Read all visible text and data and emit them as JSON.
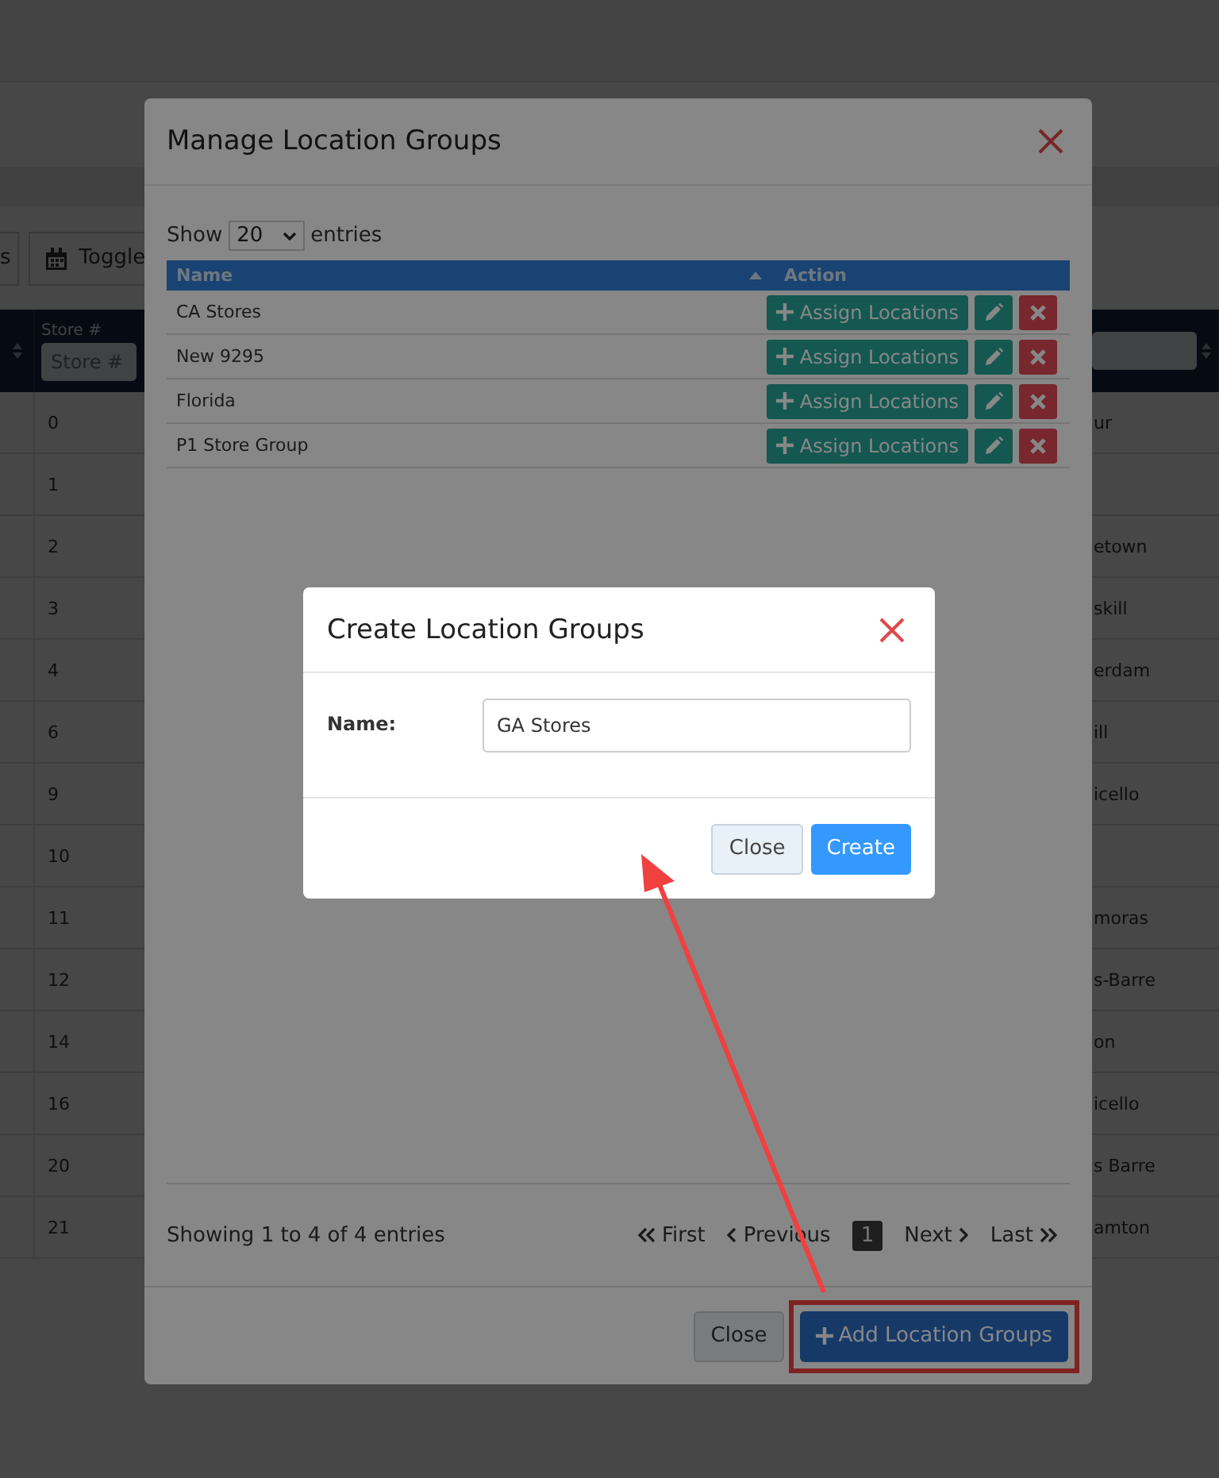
{
  "background_page": {
    "toolbar_items": [
      {
        "label": "s",
        "kind": "text"
      },
      {
        "label": "Toggle",
        "kind": "calendar"
      }
    ],
    "table": {
      "columns": [
        {
          "kind": "sort"
        },
        {
          "kind": "filter",
          "label": "Store #",
          "placeholder": "Store #"
        },
        {
          "kind": "filter_sort"
        }
      ],
      "rows": [
        {
          "store": "0",
          "column_3": "ur"
        },
        {
          "store": "1",
          "column_3": ""
        },
        {
          "store": "2",
          "column_3": "etown"
        },
        {
          "store": "3",
          "column_3": "skill"
        },
        {
          "store": "4",
          "column_3": "erdam"
        },
        {
          "store": "6",
          "column_3": "ill"
        },
        {
          "store": "9",
          "column_3": "icello"
        },
        {
          "store": "10",
          "column_3": ""
        },
        {
          "store": "11",
          "column_3": "moras"
        },
        {
          "store": "12",
          "column_3": "s-Barre"
        },
        {
          "store": "14",
          "column_3": "on"
        },
        {
          "store": "16",
          "column_3": "icello"
        },
        {
          "store": "20",
          "column_3": "s Barre"
        },
        {
          "store": "21",
          "column_3": "amton"
        }
      ]
    }
  },
  "manage_modal": {
    "title": "Manage Location Groups",
    "length": {
      "before": "Show",
      "value": "20",
      "after": "entries"
    },
    "columns": [
      {
        "label": "Name",
        "sorted": true
      },
      {
        "label": "Action",
        "sorted": false
      }
    ],
    "rows": [
      {
        "name": "CA Stores",
        "action": "Assign Locations"
      },
      {
        "name": "New 9295",
        "action": "Assign Locations"
      },
      {
        "name": "Florida",
        "action": "Assign Locations"
      },
      {
        "name": "P1 Store Group",
        "action": "Assign Locations"
      }
    ],
    "info": "Showing 1 to 4 of 4 entries",
    "pagination": [
      {
        "label": "First",
        "kind": "first",
        "selected": false
      },
      {
        "label": "Previous",
        "kind": "previous",
        "selected": false
      },
      {
        "label": "1",
        "kind": "page",
        "selected": true
      },
      {
        "label": "Next",
        "kind": "next",
        "selected": false
      },
      {
        "label": "Last",
        "kind": "last",
        "selected": false
      }
    ],
    "buttons": [
      {
        "label": "Close",
        "kind": "secondary",
        "highlighted": false
      },
      {
        "label": "Add Location Groups",
        "kind": "add",
        "highlighted": true
      }
    ]
  },
  "create_modal": {
    "title": "Create Location Groups",
    "field": {
      "label": "Name:",
      "value": "GA Stores"
    },
    "buttons": [
      {
        "label": "Close",
        "kind": "secondary"
      },
      {
        "label": "Create",
        "kind": "primary"
      }
    ]
  }
}
